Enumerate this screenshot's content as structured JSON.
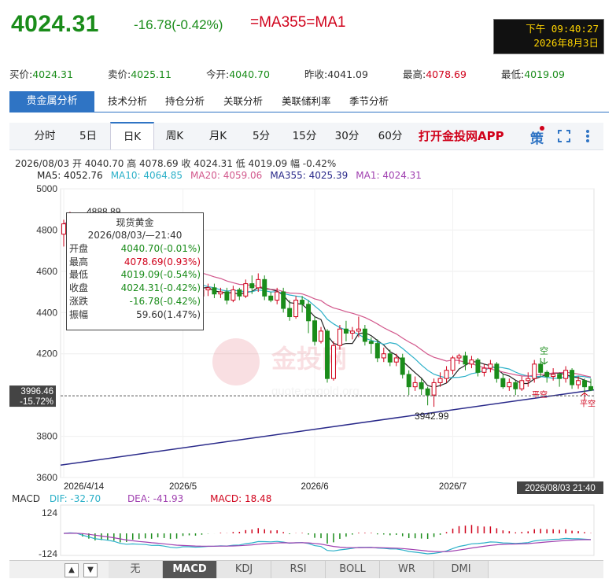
{
  "header": {
    "price": "4024.31",
    "change": "-16.78(-0.42%)",
    "ma_title": "=MA355=MA1",
    "clock_time": "下午 09:40:27",
    "clock_date": "2026年8月3日"
  },
  "quote": [
    {
      "label": "买价:",
      "value": "4024.31",
      "color": "green"
    },
    {
      "label": "卖价:",
      "value": "4025.11",
      "color": "green"
    },
    {
      "label": "今开:",
      "value": "4040.70",
      "color": "green"
    },
    {
      "label": "昨收:",
      "value": "4041.09",
      "color": "black"
    },
    {
      "label": "最高:",
      "value": "4078.69",
      "color": "red"
    },
    {
      "label": "最低:",
      "value": "4019.09",
      "color": "green"
    }
  ],
  "analysis_tabs": [
    "贵金属分析",
    "技术分析",
    "持仓分析",
    "关联分析",
    "美联储利率",
    "季节分析"
  ],
  "periods": [
    "分时",
    "5日",
    "日K",
    "周K",
    "月K",
    "5分",
    "15分",
    "30分",
    "60分"
  ],
  "active_period": "日K",
  "app_link": "打开金投网APP",
  "strategy_label": "策",
  "ohlc_line": "2026/08/03  开 4040.70  高 4078.69  收 4024.31  低 4019.09  幅 -0.42%",
  "ma_legend": [
    {
      "text": "MA5: 4052.76",
      "color": "#222222"
    },
    {
      "text": "MA10: 4064.85",
      "color": "#2bb0c8"
    },
    {
      "text": "MA20: 4059.06",
      "color": "#d2588c"
    },
    {
      "text": "MA355: 4025.39",
      "color": "#2a2a8a"
    },
    {
      "text": "MA1: 4024.31",
      "color": "#a040b0"
    }
  ],
  "chart_data": {
    "type": "candlestick",
    "y_ticks": [
      "5000",
      "4800",
      "4600",
      "4400",
      "4200",
      "3800",
      "3600"
    ],
    "y_range": [
      3600,
      5000
    ],
    "x_ticks": [
      "2026/4/14",
      "2026/5",
      "2026/6",
      "2026/7"
    ],
    "x_current": "2026/08/03 21:40",
    "cursor_price": "3996.46",
    "cursor_pct": "-15.72%",
    "annotations": {
      "high": "4888.89",
      "low": "3942.99"
    },
    "candles": [
      [
        4780,
        4830,
        4720,
        4850
      ],
      [
        4830,
        4860,
        4800,
        4889
      ],
      [
        4860,
        4820,
        4790,
        4870
      ],
      [
        4820,
        4700,
        4680,
        4840
      ],
      [
        4700,
        4690,
        4640,
        4750
      ],
      [
        4690,
        4660,
        4620,
        4720
      ],
      [
        4660,
        4700,
        4640,
        4720
      ],
      [
        4700,
        4680,
        4650,
        4730
      ],
      [
        4680,
        4640,
        4600,
        4700
      ],
      [
        4640,
        4560,
        4540,
        4660
      ],
      [
        4560,
        4600,
        4540,
        4620
      ],
      [
        4600,
        4660,
        4580,
        4680
      ],
      [
        4660,
        4610,
        4590,
        4690
      ],
      [
        4610,
        4600,
        4560,
        4640
      ],
      [
        4600,
        4550,
        4520,
        4620
      ],
      [
        4550,
        4600,
        4540,
        4630
      ],
      [
        4600,
        4520,
        4480,
        4620
      ],
      [
        4520,
        4480,
        4460,
        4540
      ],
      [
        4480,
        4500,
        4460,
        4530
      ],
      [
        4500,
        4580,
        4490,
        4600
      ],
      [
        4580,
        4520,
        4500,
        4600
      ],
      [
        4520,
        4480,
        4460,
        4550
      ],
      [
        4480,
        4510,
        4470,
        4530
      ],
      [
        4510,
        4520,
        4480,
        4540
      ],
      [
        4520,
        4490,
        4470,
        4540
      ],
      [
        4490,
        4500,
        4470,
        4520
      ],
      [
        4500,
        4460,
        4440,
        4520
      ],
      [
        4460,
        4510,
        4450,
        4530
      ],
      [
        4510,
        4480,
        4460,
        4520
      ],
      [
        4480,
        4540,
        4470,
        4560
      ],
      [
        4540,
        4520,
        4490,
        4580
      ],
      [
        4520,
        4560,
        4500,
        4590
      ],
      [
        4560,
        4480,
        4460,
        4580
      ],
      [
        4480,
        4460,
        4450,
        4500
      ],
      [
        4460,
        4500,
        4440,
        4520
      ],
      [
        4500,
        4420,
        4400,
        4520
      ],
      [
        4420,
        4380,
        4360,
        4460
      ],
      [
        4380,
        4460,
        4370,
        4480
      ],
      [
        4460,
        4440,
        4400,
        4480
      ],
      [
        4440,
        4360,
        4300,
        4460
      ],
      [
        4360,
        4260,
        4240,
        4380
      ],
      [
        4260,
        4310,
        4250,
        4330
      ],
      [
        4310,
        4080,
        4060,
        4320
      ],
      [
        4080,
        4240,
        4070,
        4260
      ],
      [
        4240,
        4320,
        4220,
        4340
      ],
      [
        4320,
        4300,
        4260,
        4360
      ],
      [
        4300,
        4310,
        4270,
        4330
      ],
      [
        4310,
        4320,
        4280,
        4380
      ],
      [
        4320,
        4260,
        4240,
        4340
      ],
      [
        4260,
        4250,
        4200,
        4280
      ],
      [
        4250,
        4180,
        4160,
        4270
      ],
      [
        4180,
        4200,
        4160,
        4230
      ],
      [
        4200,
        4160,
        4140,
        4220
      ],
      [
        4160,
        4180,
        4140,
        4200
      ],
      [
        4180,
        4100,
        4080,
        4200
      ],
      [
        4100,
        4040,
        4000,
        4120
      ],
      [
        4040,
        4060,
        4020,
        4090
      ],
      [
        4060,
        4030,
        4000,
        4080
      ],
      [
        4030,
        4000,
        3950,
        4040
      ],
      [
        4000,
        4060,
        3943,
        4080
      ],
      [
        4060,
        4080,
        4040,
        4110
      ],
      [
        4080,
        4120,
        4060,
        4140
      ],
      [
        4120,
        4180,
        4100,
        4190
      ],
      [
        4180,
        4190,
        4150,
        4200
      ],
      [
        4190,
        4150,
        4120,
        4210
      ],
      [
        4150,
        4170,
        4130,
        4190
      ],
      [
        4170,
        4110,
        4090,
        4180
      ],
      [
        4110,
        4130,
        4090,
        4150
      ],
      [
        4130,
        4150,
        4110,
        4170
      ],
      [
        4150,
        4080,
        4060,
        4160
      ],
      [
        4080,
        4040,
        4030,
        4100
      ],
      [
        4040,
        4060,
        4020,
        4080
      ],
      [
        4060,
        4030,
        4000,
        4070
      ],
      [
        4030,
        4070,
        4020,
        4090
      ],
      [
        4070,
        4080,
        4040,
        4110
      ],
      [
        4080,
        4150,
        4060,
        4170
      ],
      [
        4150,
        4110,
        4090,
        4180
      ],
      [
        4110,
        4090,
        4060,
        4120
      ],
      [
        4090,
        4100,
        4070,
        4130
      ],
      [
        4100,
        4080,
        4040,
        4110
      ],
      [
        4080,
        4120,
        4060,
        4140
      ],
      [
        4120,
        4050,
        4030,
        4130
      ],
      [
        4050,
        4070,
        4030,
        4090
      ],
      [
        4070,
        4040,
        4010,
        4080
      ],
      [
        4041,
        4024,
        4019,
        4079
      ]
    ],
    "macd": {
      "label": "MACD",
      "dif": "DIF: -32.70",
      "dea": "DEA: -41.93",
      "macd": "MACD: 18.48",
      "y_ticks": [
        "124",
        "-124"
      ]
    }
  },
  "tooltip": {
    "title": "现货黄金",
    "date": "2026/08/03/—21:40",
    "rows": [
      {
        "k": "开盘",
        "v": "4040.70(-0.01%)",
        "c": "green"
      },
      {
        "k": "最高",
        "v": "4078.69(0.93%)",
        "c": "red"
      },
      {
        "k": "最低",
        "v": "4019.09(-0.54%)",
        "c": "green"
      },
      {
        "k": "收盘",
        "v": "4024.31(-0.42%)",
        "c": "green"
      },
      {
        "k": "涨跌",
        "v": "-16.78(-0.42%)",
        "c": "green"
      },
      {
        "k": "振幅",
        "v": "59.60(1.47%)",
        "c": "black"
      }
    ]
  },
  "markers": {
    "kong": "空",
    "ping": "平空",
    "pingkong": "平空"
  },
  "watermark": {
    "text": "金投网",
    "url": "quote.cngold.org"
  },
  "indicators": [
    "无",
    "MACD",
    "KDJ",
    "RSI",
    "BOLL",
    "WR",
    "DMI"
  ],
  "active_indicator": "MACD",
  "colors": {
    "up": "#d0021b",
    "down": "#1a8c1a",
    "accent": "#2f74c4"
  }
}
